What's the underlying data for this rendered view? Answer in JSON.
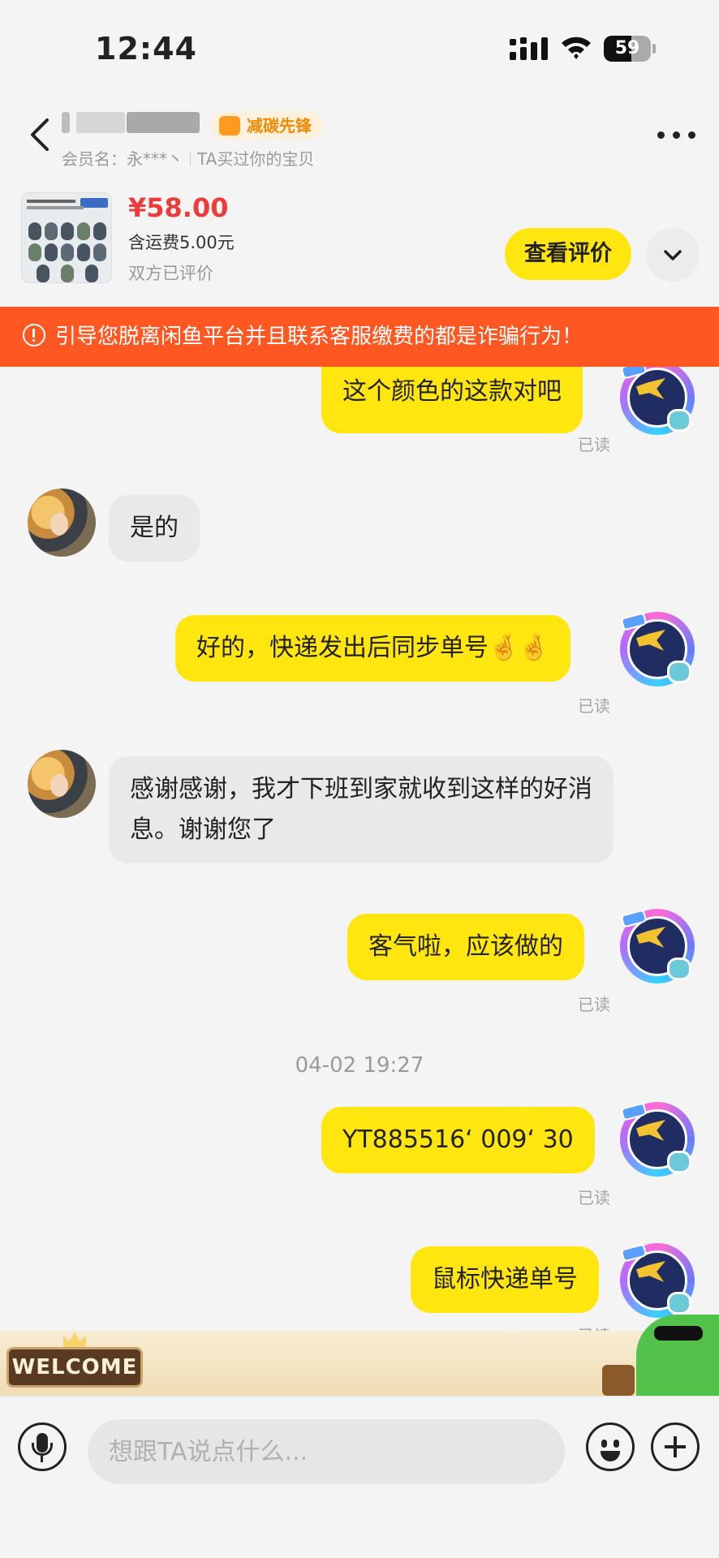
{
  "status_bar": {
    "time": "12:44",
    "battery": "59",
    "battery_level": 0.59
  },
  "header": {
    "badge": "减碳先锋",
    "member_label": "会员名：",
    "member_name": "永***丶",
    "member_note": "TA买过你的宝贝"
  },
  "product": {
    "price": "¥58.00",
    "shipping": "含运费5.00元",
    "status": "双方已评价",
    "review_button": "查看评价"
  },
  "warning": {
    "text": "引导您脱离闲鱼平台并且联系客服缴费的都是诈骗行为！"
  },
  "messages": [
    {
      "from": "me",
      "text": "这个颜色的这款对吧",
      "read": "已读"
    },
    {
      "from": "other",
      "text": "是的"
    },
    {
      "from": "me",
      "text": "好的，快递发出后同步单号🤞🤞",
      "read": "已读"
    },
    {
      "from": "other",
      "text": "感谢感谢，我才下班到家就收到这样的好消息。谢谢您了"
    },
    {
      "from": "me",
      "text": "客气啦，应该做的",
      "read": "已读"
    },
    {
      "type": "timestamp",
      "text": "04-02 19:27"
    },
    {
      "from": "me",
      "text": "YT885516‘ 009‘ 30",
      "read": "已读"
    },
    {
      "from": "me",
      "text": "鼠标快递单号",
      "read": "已读"
    }
  ],
  "welcome": "WELCOME",
  "input": {
    "placeholder": "想跟TA说点什么..."
  },
  "colors": {
    "accent": "#ffe60f",
    "warning": "#fe5722",
    "price": "#ee3a3a"
  }
}
